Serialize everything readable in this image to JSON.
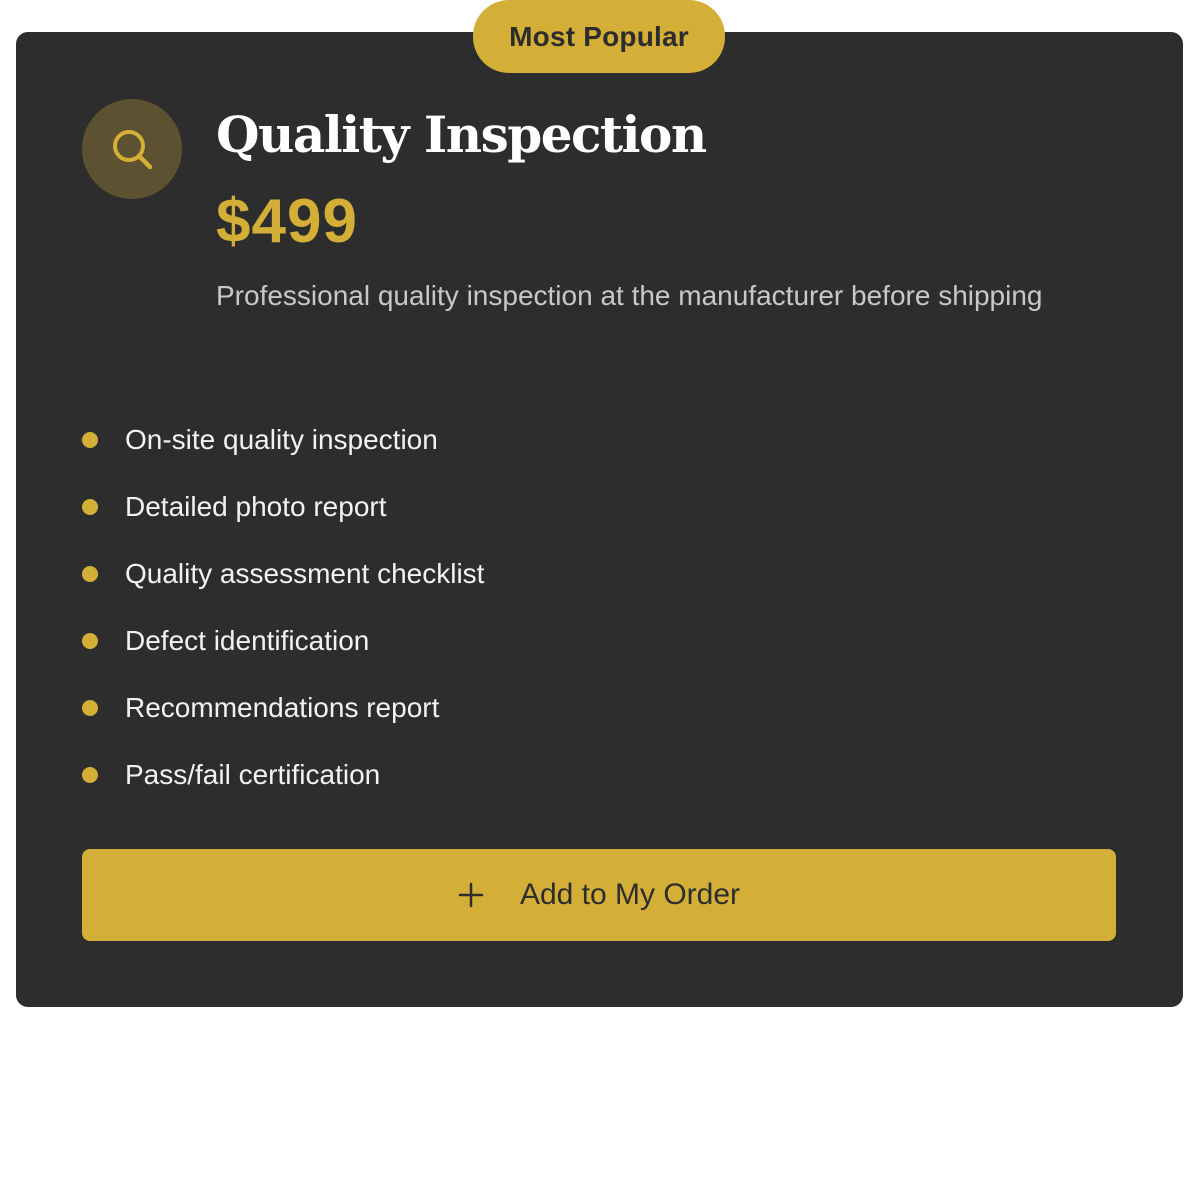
{
  "card": {
    "badge": "Most Popular",
    "icon": "search-icon",
    "title": "Quality Inspection",
    "price": "$499",
    "description": "Professional quality inspection at the manufacturer before shipping",
    "features": [
      "On-site quality inspection",
      "Detailed photo report",
      "Quality assessment checklist",
      "Defect identification",
      "Recommendations report",
      "Pass/fail certification"
    ],
    "button": {
      "icon": "plus-icon",
      "label": "Add to My Order"
    }
  },
  "colors": {
    "card_background": "#2d2d2d",
    "accent": "#d4af37",
    "text_primary": "#ffffff",
    "text_secondary": "#c8c8c8",
    "page_background": "#ffffff"
  }
}
